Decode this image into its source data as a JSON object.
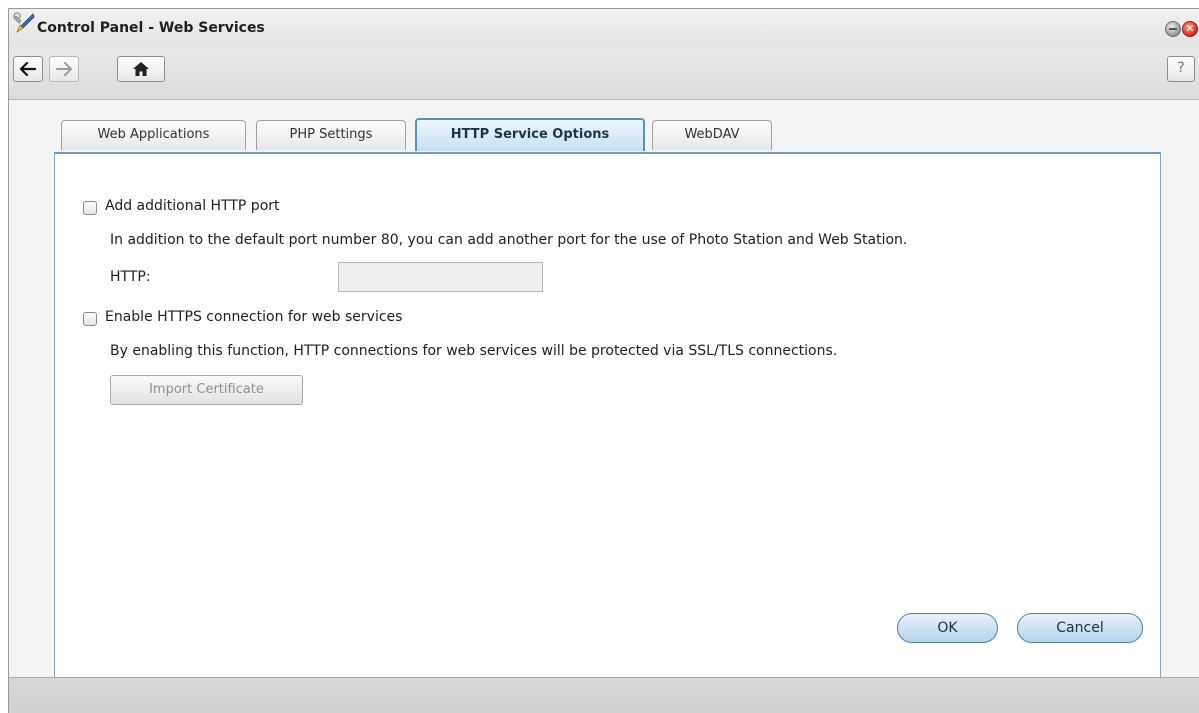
{
  "window": {
    "title": "Control Panel - Web Services",
    "close_glyph": "✕"
  },
  "toolbar": {
    "back_glyph": "←",
    "forward_glyph": "→",
    "home_glyph": "⌂",
    "help_label": "?"
  },
  "tabs": [
    {
      "label": "Web Applications",
      "active": false
    },
    {
      "label": "PHP Settings",
      "active": false
    },
    {
      "label": "HTTP Service Options",
      "active": true
    },
    {
      "label": "WebDAV",
      "active": false
    }
  ],
  "http_port": {
    "checkbox_label": "Add additional HTTP port",
    "checked": false,
    "description": "In addition to the default port number 80, you can add another port for the use of Photo Station and Web Station.",
    "field_label": "HTTP:",
    "field_value": ""
  },
  "https": {
    "checkbox_label": "Enable HTTPS connection for web services",
    "checked": false,
    "description": "By enabling this function, HTTP connections for web services will be protected via SSL/TLS connections.",
    "import_button_label": "Import Certificate"
  },
  "footer": {
    "ok_label": "OK",
    "cancel_label": "Cancel"
  },
  "icons": {
    "app": "control-panel-tools-icon",
    "minimize": "minimize-icon",
    "close": "close-icon",
    "back": "back-arrow-icon",
    "forward": "forward-arrow-icon",
    "home": "home-icon",
    "help": "help-icon"
  },
  "colors": {
    "active_tab_border": "#5a8fc0",
    "panel_border": "#7ea6c9",
    "close_button": "#d42a1a"
  }
}
